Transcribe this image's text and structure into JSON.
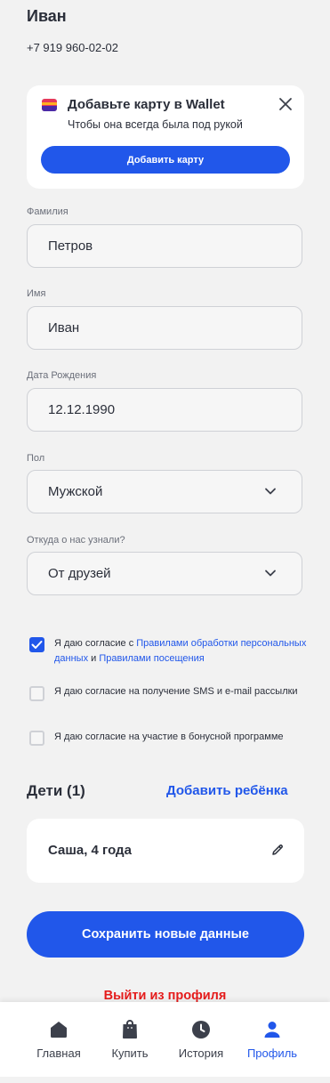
{
  "profile": {
    "name": "Иван",
    "phone": "+7 919 960-02-02"
  },
  "wallet_banner": {
    "title": "Добавьте карту в Wallet",
    "subtitle": "Чтобы она всегда была под рукой",
    "button_label": "Добавить карту"
  },
  "form": {
    "last_name": {
      "label": "Фамилия",
      "value": "Петров"
    },
    "first_name": {
      "label": "Имя",
      "value": "Иван"
    },
    "birth_date": {
      "label": "Дата Рождения",
      "value": "12.12.1990"
    },
    "gender": {
      "label": "Пол",
      "value": "Мужской"
    },
    "source": {
      "label": "Откуда о нас узнали?",
      "value": "От друзей"
    }
  },
  "consents": [
    {
      "checked": true,
      "text_prefix": "Я даю согласие с ",
      "link1": "Правилами обработки персональных данных",
      "text_mid": " и ",
      "link2": "Правилами посещения"
    },
    {
      "checked": false,
      "text": "Я даю согласие на получение SMS и e-mail рассылки"
    },
    {
      "checked": false,
      "text": "Я даю согласие на участие в бонусной программе"
    }
  ],
  "children": {
    "title": "Дети (1)",
    "add_label": "Добавить ребёнка",
    "items": [
      {
        "name": "Саша, 4 года"
      }
    ]
  },
  "actions": {
    "save_label": "Сохранить новые данные",
    "logout_label": "Выйти из профиля"
  },
  "bottom_nav": [
    {
      "label": "Главная",
      "icon": "home-icon",
      "active": false
    },
    {
      "label": "Купить",
      "icon": "shopping-bag-icon",
      "active": false
    },
    {
      "label": "История",
      "icon": "clock-icon",
      "active": false
    },
    {
      "label": "Профиль",
      "icon": "user-icon",
      "active": true
    }
  ],
  "colors": {
    "accent": "#2157ea",
    "danger": "#e51b1b",
    "background": "#f2f2f2",
    "card": "#ffffff"
  }
}
